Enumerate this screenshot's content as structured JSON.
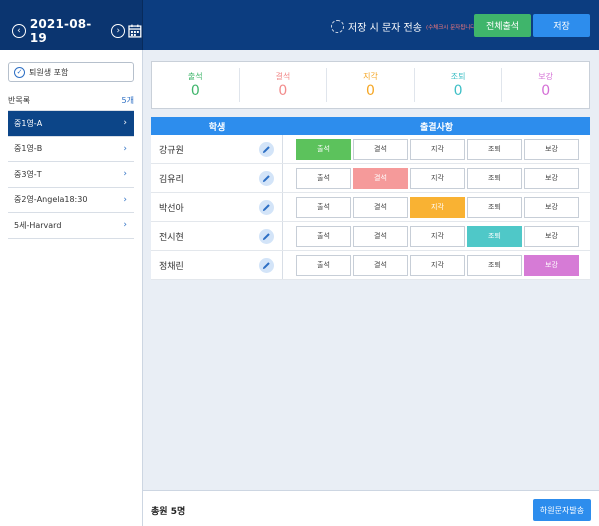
{
  "header": {
    "date": "2021-08-19",
    "prev_icon": "chevron-left-icon",
    "next_icon": "chevron-right-icon",
    "calendar_icon": "calendar-icon",
    "sms_label": "저장 시 문자 전송",
    "sms_note": "(수체크시 문자됩니다)",
    "all_present_label": "전체출석",
    "save_label": "저장",
    "colors": {
      "bar": "#0c3d80",
      "green": "#3fb56b",
      "blue": "#2d8ded"
    }
  },
  "sidebar": {
    "withdrawn_label": "퇴원생 포함",
    "list_title": "반목록",
    "list_count": "5개",
    "classes": [
      {
        "label": "중1영-A",
        "active": true
      },
      {
        "label": "중1영-B",
        "active": false
      },
      {
        "label": "중3영-T",
        "active": false
      },
      {
        "label": "중2영-Angela18:30",
        "active": false
      },
      {
        "label": "5세-Harvard",
        "active": false
      }
    ]
  },
  "summary": [
    {
      "label": "출석",
      "value": "0",
      "color": "#3fb56b"
    },
    {
      "label": "결석",
      "value": "0",
      "color": "#f28b8b"
    },
    {
      "label": "지각",
      "value": "0",
      "color": "#f5a623"
    },
    {
      "label": "조퇴",
      "value": "0",
      "color": "#3ebfc6"
    },
    {
      "label": "보강",
      "value": "0",
      "color": "#d46fd6"
    }
  ],
  "table": {
    "col_student": "학생",
    "col_status": "출결사항",
    "status_labels": [
      "출석",
      "결석",
      "지각",
      "조퇴",
      "보강"
    ],
    "status_colors": [
      "#5cc25c",
      "#f59a9a",
      "#f9b233",
      "#4fc8c8",
      "#d67bd6"
    ],
    "rows": [
      {
        "name": "강규원",
        "selected": 0
      },
      {
        "name": "김유리",
        "selected": 1
      },
      {
        "name": "박선아",
        "selected": 2
      },
      {
        "name": "전시현",
        "selected": 3
      },
      {
        "name": "정채린",
        "selected": 4
      }
    ]
  },
  "footer": {
    "total": "총원 5명",
    "sms_send_label": "하원문자발송"
  }
}
